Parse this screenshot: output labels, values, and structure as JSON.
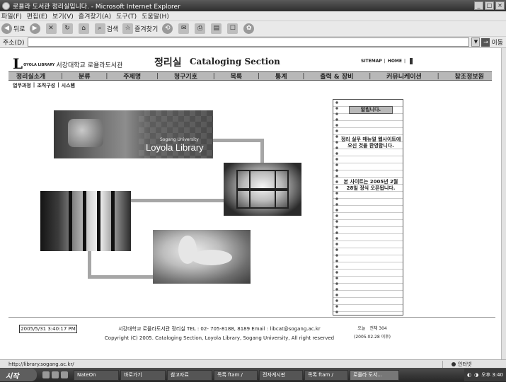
{
  "window": {
    "title": "로욜라 도서관 정리실입니다. - Microsoft Internet Explorer",
    "controls": [
      "_",
      "□",
      "×"
    ]
  },
  "menubar": [
    "파일(F)",
    "편집(E)",
    "보기(V)",
    "즐겨찾기(A)",
    "도구(T)",
    "도움말(H)"
  ],
  "toolbar": {
    "back": "뒤로",
    "search": "검색",
    "favorites": "즐겨찾기"
  },
  "address": {
    "label": "주소(D)",
    "value": "",
    "go": "이동"
  },
  "header": {
    "logo_letter": "L",
    "logo_small": "OYOLA LIBRARY",
    "logo_kr": "서강대학교 로욜라도서관",
    "title_kr": "정리실",
    "title_en": "Cataloging Section",
    "links": [
      "SITEMAP",
      "HOME"
    ]
  },
  "mainnav": [
    "정리실소개",
    "분류",
    "주제명",
    "청구기호",
    "목록",
    "통계",
    "출력 & 장비",
    "커뮤니케이션",
    "참조정보원"
  ],
  "subnav": [
    "업무과정",
    "조직구성",
    "시스템"
  ],
  "collage": {
    "brand_sub": "Sogang University",
    "brand": "Loyola Library"
  },
  "notebook": {
    "greeting": "알립니다.",
    "message1": "정리 실무 매뉴얼 웹사이트에 오신 것을 환영합니다.",
    "message2": "본 사이트는 2005년 2월 28일 정식 오픈됩니다."
  },
  "footer": {
    "datetime": "2005/5/31 3:40:17 PM",
    "line1": "서강대학교 로욜라도서관 정리실 TEL : 02- 705-8188, 8189 Email : libcat@sogang.ac.kr",
    "line2": "Copyright (C) 2005. Cataloging Section, Loyola Library, Sogang University, All right reserved",
    "counter_today": "오늘",
    "counter_total": "전체 304",
    "counter_since": "(2005.02.28 이후)"
  },
  "statusbar": {
    "url": "http://library.sogang.ac.kr/",
    "zone": "인터넷"
  },
  "taskbar": {
    "start": "시작",
    "tasks": [
      "NateOn",
      "바로가기",
      "참고자료",
      "목록 ftam /",
      "전자게시판",
      "목록 ftam /",
      "로욜라 도서..."
    ],
    "clock": "오후 3:40"
  }
}
